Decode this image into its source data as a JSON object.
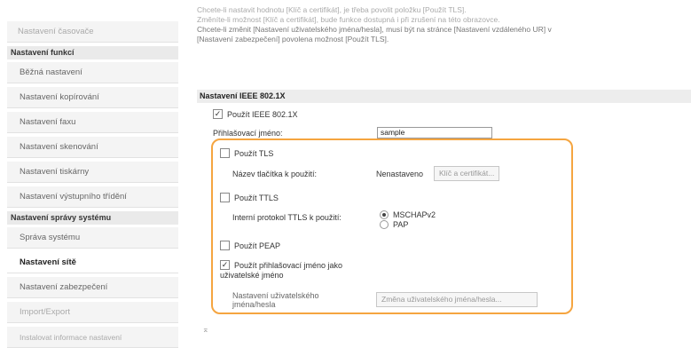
{
  "sidebar": {
    "top_item": "Nastavení časovače",
    "section_function": "Nastavení funkcí",
    "function_items": [
      "Běžná nastavení",
      "Nastavení kopírování",
      "Nastavení faxu",
      "Nastavení skenování",
      "Nastavení tiskárny",
      "Nastavení výstupního třídění"
    ],
    "section_system": "Nastavení správy systému",
    "system_items": [
      "Správa systému",
      "Nastavení sítě",
      "Nastavení zabezpečení",
      "Import/Export",
      "Instalovat informace nastavení"
    ]
  },
  "note": {
    "line1": "Chcete-li nastavit hodnotu [Klíč a certifikát], je třeba povolit položku [Použít TLS].",
    "line2": "Změníte-li možnost [Klíč a certifikát], bude funkce dostupná i při zrušení na této obrazovce.",
    "line3": "Chcete-li změnit [Nastavení uživatelského jména/hesla], musí být na stránce [Nastavení vzdáleného UR] v [Nastavení zabezpečení] povolena možnost [Použít TLS]."
  },
  "section": {
    "title": "Nastavení IEEE 802.1X",
    "use_ieee_label": "Použít IEEE 802.1X",
    "login_name_label": "Přihlašovací jméno:",
    "login_name_value": "sample",
    "use_tls_label": "Použít TLS",
    "key_name_label": "Název tlačítka k použití:",
    "key_status": "Nenastaveno",
    "key_button": "Klíč a certifikát...",
    "use_ttls_label": "Použít TTLS",
    "ttls_protocol_label": "Interní protokol TTLS k použití:",
    "ttls_options": [
      "MSCHAPv2",
      "PAP"
    ],
    "use_peap_label": "Použít PEAP",
    "use_login_as_user_label": "Použít přihlašovací jméno jako uživatelské jméno",
    "user_settings_label": "Nastavení uživatelského jména/hesla",
    "user_settings_button": "Změna uživatelského jména/hesla..."
  },
  "footer_mark": "⌅",
  "colors": {
    "highlight": "#f5a540"
  }
}
